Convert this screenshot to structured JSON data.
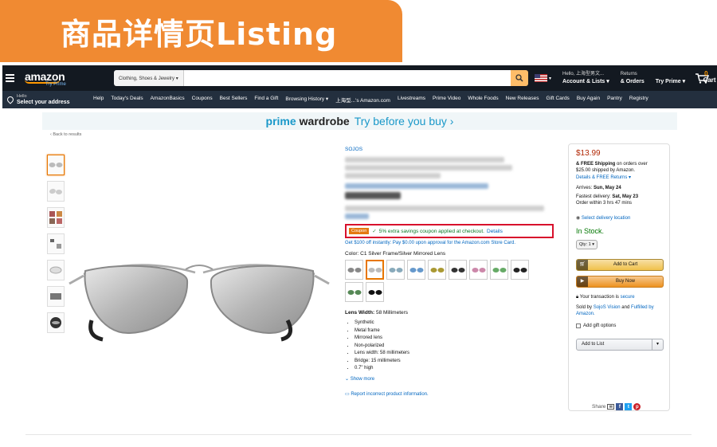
{
  "banner": {
    "title": "商品详情页Listing"
  },
  "header": {
    "logo": "amazon",
    "logo_sub": "Try Prime",
    "search_category": "Clothing, Shoes & Jewelry ▾",
    "search_placeholder": "",
    "account_hello": "Hello, 上海型男文...",
    "account_label": "Account & Lists ▾",
    "returns_l1": "Returns",
    "returns_l2": "& Orders",
    "try_prime": "Try Prime ▾",
    "cart_count": "0",
    "cart_label": "Cart"
  },
  "subnav": {
    "hello": "Hello",
    "address": "Select your address",
    "links": [
      "Help",
      "Today's Deals",
      "AmazonBasics",
      "Coupons",
      "Best Sellers",
      "Find a Gift",
      "Browsing History ▾",
      "上海型...'s Amazon.com",
      "Livestreams",
      "Prime Video",
      "Whole Foods",
      "New Releases",
      "Gift Cards",
      "Buy Again",
      "Pantry",
      "Registry"
    ]
  },
  "promo": {
    "prime": "prime",
    "wardrobe": "wardrobe",
    "cta": "Try before you buy ›"
  },
  "back_link": "‹ Back to results",
  "product": {
    "brand": "SOJOS",
    "coupon_tag": "Coupon",
    "coupon_text": "5% extra savings coupon applied at checkout.",
    "coupon_link": "Details",
    "card_offer": "Get $100 off instantly: Pay $0.00 upon approval for the Amazon.com Store Card.",
    "color_label": "Color:",
    "color_value": "C1 Silver Frame/Silver Mirrored Lens",
    "lens_width_label": "Lens Width:",
    "lens_width_value": "58 Millimeters",
    "bullets": [
      "Synthetic",
      "Metal frame",
      "Mirrored lens",
      "Non-polarized",
      "Lens width: 58 millimeters",
      "Bridge: 15 millimeters",
      "0.7\" high"
    ],
    "show_more": "Show more",
    "report": "Report incorrect product information."
  },
  "buybox": {
    "price": "$13.99",
    "shipping_bold": "& FREE Shipping",
    "shipping_rest": "on orders over $25.00 shipped by Amazon.",
    "details": "Details",
    "free_returns": "& FREE Returns ▾",
    "arrives_label": "Arrives:",
    "arrives_date": "Sun, May 24",
    "fastest_label": "Fastest delivery:",
    "fastest_date": "Sat, May 23",
    "order_within": "Order within 3 hrs 47 mins",
    "delivery_location": "Select delivery location",
    "stock": "In Stock.",
    "qty": "Qty: 1 ▾",
    "add_to_cart": "Add to Cart",
    "buy_now": "Buy Now",
    "secure_pre": "Your transaction is",
    "secure": "secure",
    "sold_by_pre": "Sold by",
    "seller": "SojoS Vision",
    "fulfilled_pre": "and",
    "fulfilled": "Fulfilled by Amazon.",
    "gift": "Add gift options",
    "add_to_list": "Add to List",
    "share": "Share"
  }
}
